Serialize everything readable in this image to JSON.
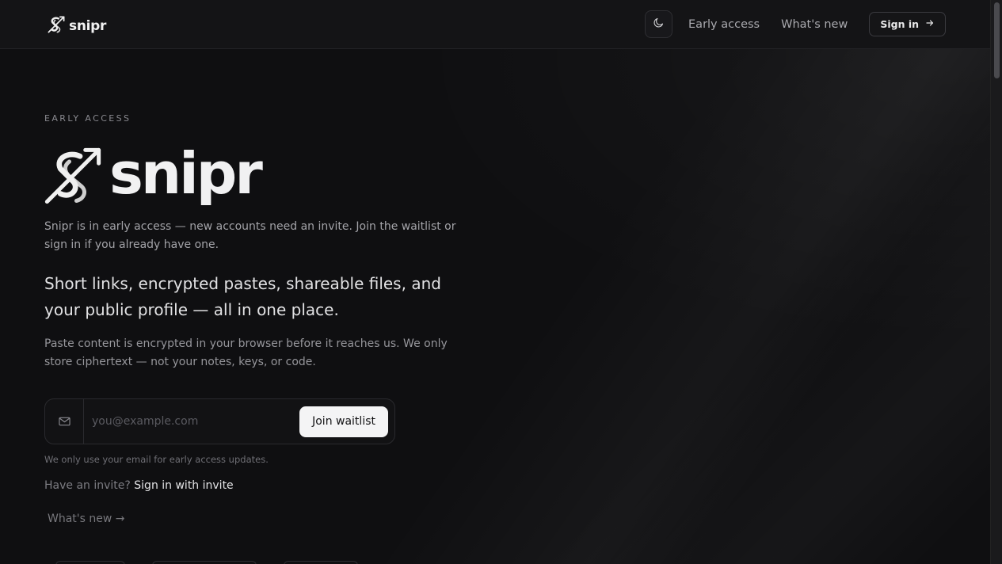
{
  "header": {
    "brand": "snipr",
    "nav": {
      "early_access": "Early access",
      "whats_new": "What's new",
      "sign_in": "Sign in"
    }
  },
  "hero": {
    "eyebrow": "EARLY ACCESS",
    "logo_word": "snipr",
    "intro": "Snipr is in early access — new accounts need an invite. Join the waitlist or sign in if you already have one.",
    "tagline": "Short links, encrypted pastes, shareable files, and your public profile — all in one place.",
    "privacy": "Paste content is encrypted in your browser before it reaches us. We only store ciphertext — not your notes, keys, or code."
  },
  "waitlist": {
    "email_placeholder": "you@example.com",
    "email_value": "",
    "join_label": "Join waitlist",
    "note": "We only use your email for early access updates."
  },
  "invite": {
    "prompt": "Have an invite?",
    "link": "Sign in with invite"
  },
  "footer_link": "What's new →",
  "icons": {
    "logo": "snipr-logo-icon",
    "theme": "moon-icon",
    "arrow": "arrow-right-icon",
    "mail": "mail-icon"
  }
}
